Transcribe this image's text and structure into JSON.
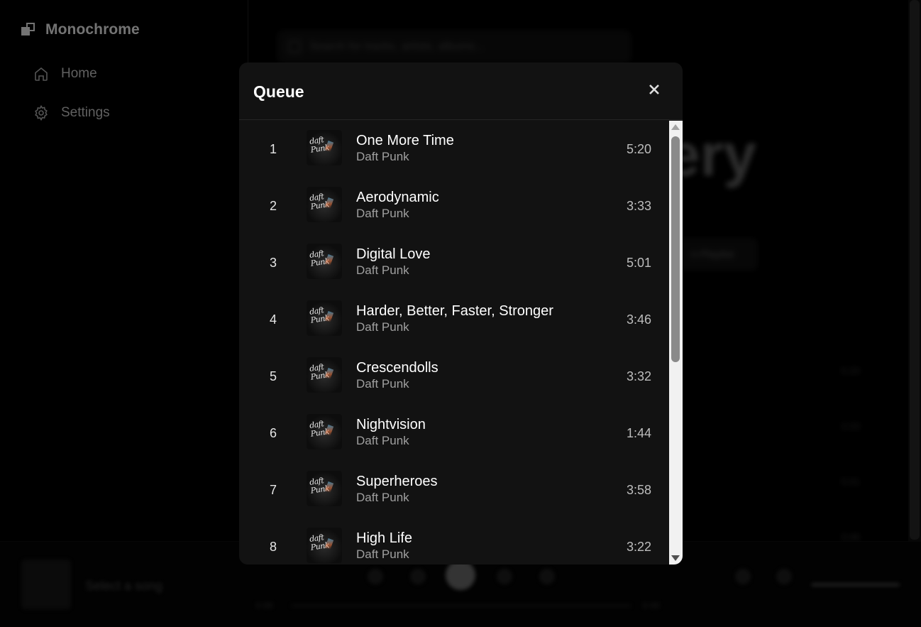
{
  "app": {
    "title": "Monochrome"
  },
  "sidebar": {
    "items": [
      {
        "label": "Home",
        "icon": "home-icon"
      },
      {
        "label": "Settings",
        "icon": "settings-icon"
      }
    ]
  },
  "background": {
    "search_placeholder": "Search for tracks, artists, albums...",
    "heading_fragment": "ery",
    "button_fragment": "n Playlist",
    "durations": [
      "5:20",
      "3:33",
      "5:01",
      "3:46"
    ]
  },
  "player": {
    "placeholder": "Select a song",
    "time_current": "0:00",
    "time_total": "0:00"
  },
  "queue": {
    "title": "Queue",
    "tracks": [
      {
        "number": "1",
        "title": "One More Time",
        "artist": "Daft Punk",
        "duration": "5:20"
      },
      {
        "number": "2",
        "title": "Aerodynamic",
        "artist": "Daft Punk",
        "duration": "3:33"
      },
      {
        "number": "3",
        "title": "Digital Love",
        "artist": "Daft Punk",
        "duration": "5:01"
      },
      {
        "number": "4",
        "title": "Harder, Better, Faster, Stronger",
        "artist": "Daft Punk",
        "duration": "3:46"
      },
      {
        "number": "5",
        "title": "Crescendolls",
        "artist": "Daft Punk",
        "duration": "3:32"
      },
      {
        "number": "6",
        "title": "Nightvision",
        "artist": "Daft Punk",
        "duration": "1:44"
      },
      {
        "number": "7",
        "title": "Superheroes",
        "artist": "Daft Punk",
        "duration": "3:58"
      },
      {
        "number": "8",
        "title": "High Life",
        "artist": "Daft Punk",
        "duration": "3:22"
      }
    ]
  },
  "colors": {
    "background": "#000000",
    "modal": "#121212",
    "text_primary": "#ffffff",
    "text_secondary": "#a0a0a0"
  }
}
